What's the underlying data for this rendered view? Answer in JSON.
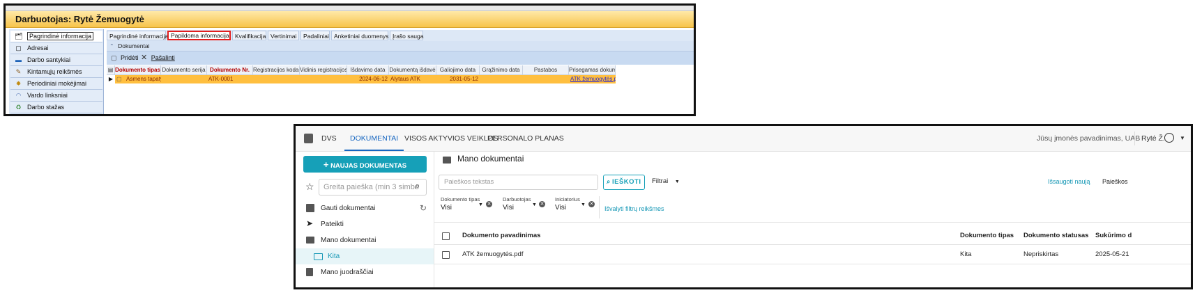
{
  "legacy": {
    "title": "Darbuotojas: Rytė Žemuogytė",
    "nav": [
      {
        "label": "Pagrindinė informacija",
        "icon": "info-icon"
      },
      {
        "label": "Adresai",
        "icon": "address-icon"
      },
      {
        "label": "Darbo santykiai",
        "icon": "work-icon"
      },
      {
        "label": "Kintamųjų reikšmės",
        "icon": "variables-icon"
      },
      {
        "label": "Periodiniai mokėjimai",
        "icon": "payments-icon"
      },
      {
        "label": "Vardo linksniai",
        "icon": "name-icon"
      },
      {
        "label": "Darbo stažas",
        "icon": "seniority-icon"
      }
    ],
    "tabs": [
      "Pagrindinė informacija",
      "Papildoma informacija",
      "Kvalifikacija",
      "Vertinimai",
      "Padaliniai",
      "Anketiniai duomenys",
      "Įrašo sauga"
    ],
    "section": "Dokumentai",
    "toolbar": {
      "add": "Pridėti",
      "remove": "Pašalinti"
    },
    "columns": [
      "Dokumento tipas",
      "Dokumento serija",
      "Dokumento Nr.",
      "Registracijos kodas",
      "Vidinis registracijos",
      "Išdavimo data",
      "Dokumentą išdavė",
      "Galiojimo data",
      "Grąžinimo data",
      "Pastabos",
      "Prisegamas dokum"
    ],
    "row": {
      "doc_type": "Asmens tapaty",
      "doc_series": "",
      "doc_no": "ATK-0001",
      "reg_code": "",
      "internal_reg": "",
      "issue_date": "2024-06-12",
      "issued_by": "Alytaus ATK",
      "valid_until": "2031-05-12",
      "return_date": "",
      "notes": "",
      "attachment": "ATK žemuogytės.p"
    }
  },
  "dvs": {
    "nav": [
      "DVS",
      "DOKUMENTAI",
      "VISOS AKTYVIOS VEIKLOS",
      "PERSONALO PLANAS"
    ],
    "company": "Jūsų įmonės pavadinimas, UAB",
    "user": "Rytė Ž.",
    "new_doc": "NAUJAS DOKUMENTAS",
    "quick_search_placeholder": "Greita paieška (min 3 simbo",
    "sidebar": [
      "Gauti dokumentai",
      "Pateikti",
      "Mano dokumentai",
      "Kita",
      "Mano juodraščiai"
    ],
    "page_title": "Mano dokumentai",
    "search_placeholder": "Paieškos tekstas",
    "search_btn": "IEŠKOTI",
    "filters": "Filtrai",
    "save_new": "Išsaugoti naują",
    "search_right": "Paieškos",
    "filter_fields": [
      {
        "label": "Dokumento tipas",
        "value": "Visi"
      },
      {
        "label": "Darbuotojas",
        "value": "Visi"
      },
      {
        "label": "Iniciatorius",
        "value": "Visi"
      }
    ],
    "clear_filters": "Išvalyti filtrų reikšmes",
    "columns": [
      "Dokumento pavadinimas",
      "Dokumento tipas",
      "Dokumento statusas",
      "Sukūrimo d"
    ],
    "rows": [
      {
        "name": "ATK žemuogytės.pdf",
        "type": "Kita",
        "status": "Nepriskirtas",
        "created": "2025-05-21"
      }
    ],
    "colors": {
      "accent": "#16a0b8",
      "link": "#1565c0"
    }
  }
}
